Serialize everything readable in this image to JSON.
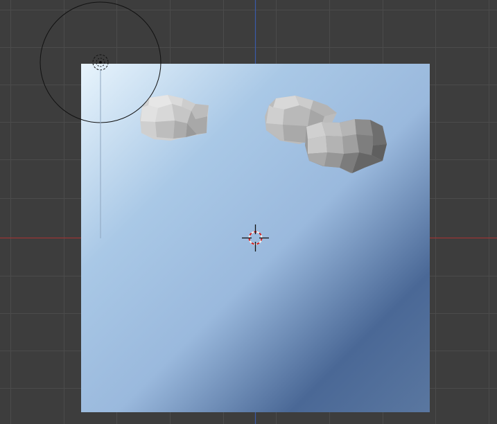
{
  "viewport": {
    "background_color": "#3d3d3d",
    "grid_line_color": "#4a4a4a",
    "x_axis_color": "#b03030",
    "y_axis_color": "#3050a8"
  },
  "camera_plane": {
    "gradient_light": "#e8f4fc",
    "gradient_mid": "#9ab9dd",
    "gradient_dark": "#4a6896"
  },
  "sun_lamp": {
    "outline_color": "#101010",
    "icon": "lamp-dashed-circle-icon"
  },
  "cursor_3d": {
    "icon": "3d-cursor-crosshair-icon",
    "ring_colors": [
      "#d02020",
      "#f2f2f2"
    ]
  },
  "clouds": [
    {
      "name": "cloud-mesh-left"
    },
    {
      "name": "cloud-mesh-middle"
    },
    {
      "name": "cloud-mesh-right"
    }
  ]
}
